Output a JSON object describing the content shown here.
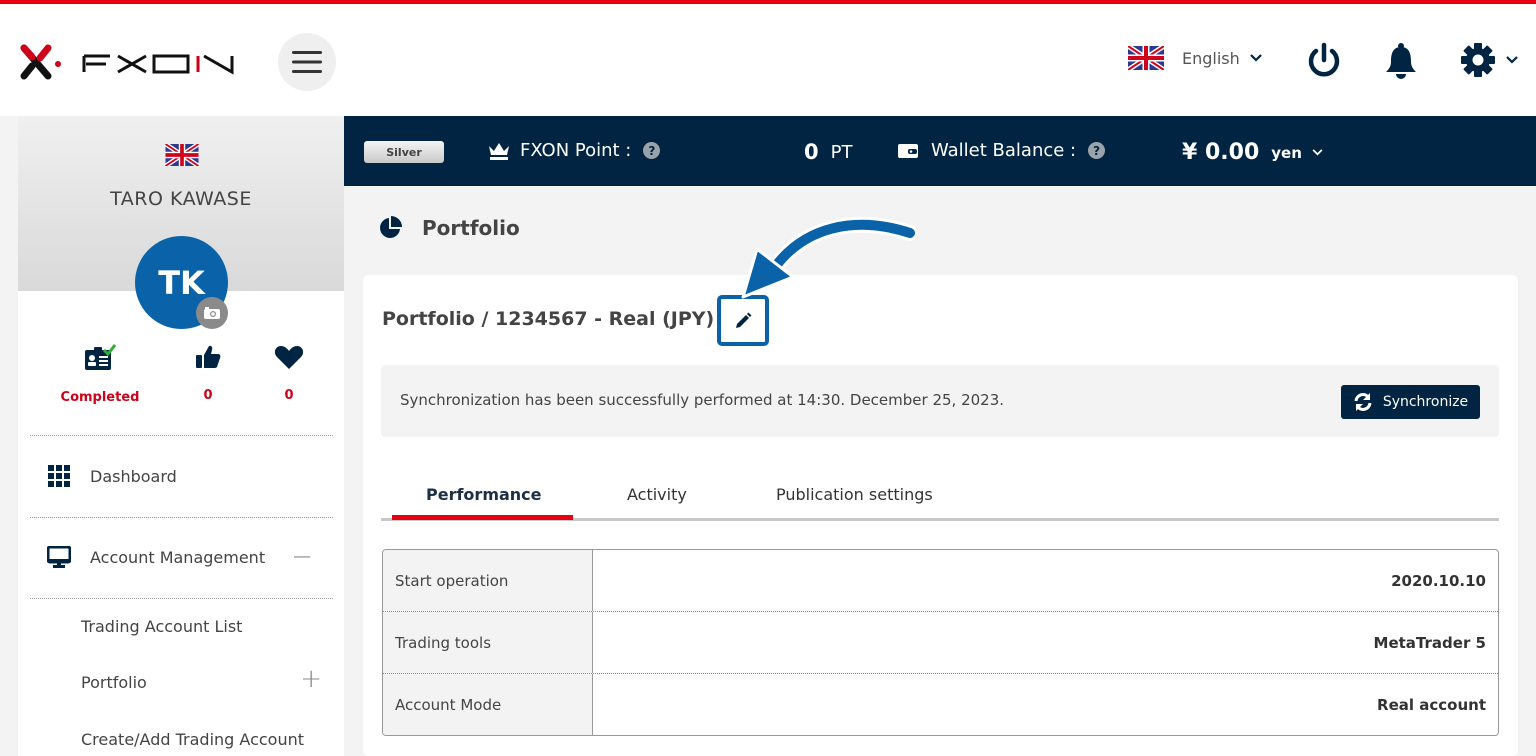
{
  "brand": {
    "name": "FXON",
    "accent": "#e60012",
    "navy": "#002441",
    "blue": "#0a63a8"
  },
  "header": {
    "language": {
      "flag": "uk-flag-icon",
      "label": "English"
    },
    "icons": [
      "power-icon",
      "bell-icon",
      "gear-icon"
    ]
  },
  "topbar": {
    "tier_badge": "Silver",
    "point_label": "FXON Point :",
    "point_value": "0",
    "point_unit": "PT",
    "wallet_label": "Wallet Balance :",
    "wallet_value": "¥ 0.00",
    "wallet_unit": "yen"
  },
  "sidebar": {
    "profile": {
      "name": "TARO KAWASE",
      "initials": "TK"
    },
    "stats": [
      {
        "icon": "id-card-check-icon",
        "value": "Completed"
      },
      {
        "icon": "thumbs-up-icon",
        "value": "0"
      },
      {
        "icon": "heart-icon",
        "value": "0"
      }
    ],
    "nav": [
      {
        "label": "Dashboard",
        "icon": "grid-icon"
      },
      {
        "label": "Account Management",
        "icon": "monitor-icon",
        "toggle": "−"
      }
    ],
    "sub_items": [
      {
        "label": "Trading Account List"
      },
      {
        "label": "Portfolio",
        "toggle": "+"
      },
      {
        "label": "Create/Add Trading Account"
      }
    ]
  },
  "main": {
    "page_title": "Portfolio",
    "card_title": "Portfolio / 1234567 - Real (JPY)",
    "sync_message": "Synchronization has been successfully performed at 14:30. December 25, 2023.",
    "sync_button": "Synchronize",
    "tabs": [
      {
        "label": "Performance",
        "active": true
      },
      {
        "label": "Activity",
        "active": false
      },
      {
        "label": "Publication settings",
        "active": false
      }
    ],
    "info_rows": [
      {
        "key": "Start operation",
        "value": "2020.10.10"
      },
      {
        "key": "Trading tools",
        "value": "MetaTrader 5"
      },
      {
        "key": "Account Mode",
        "value": "Real account"
      }
    ]
  }
}
